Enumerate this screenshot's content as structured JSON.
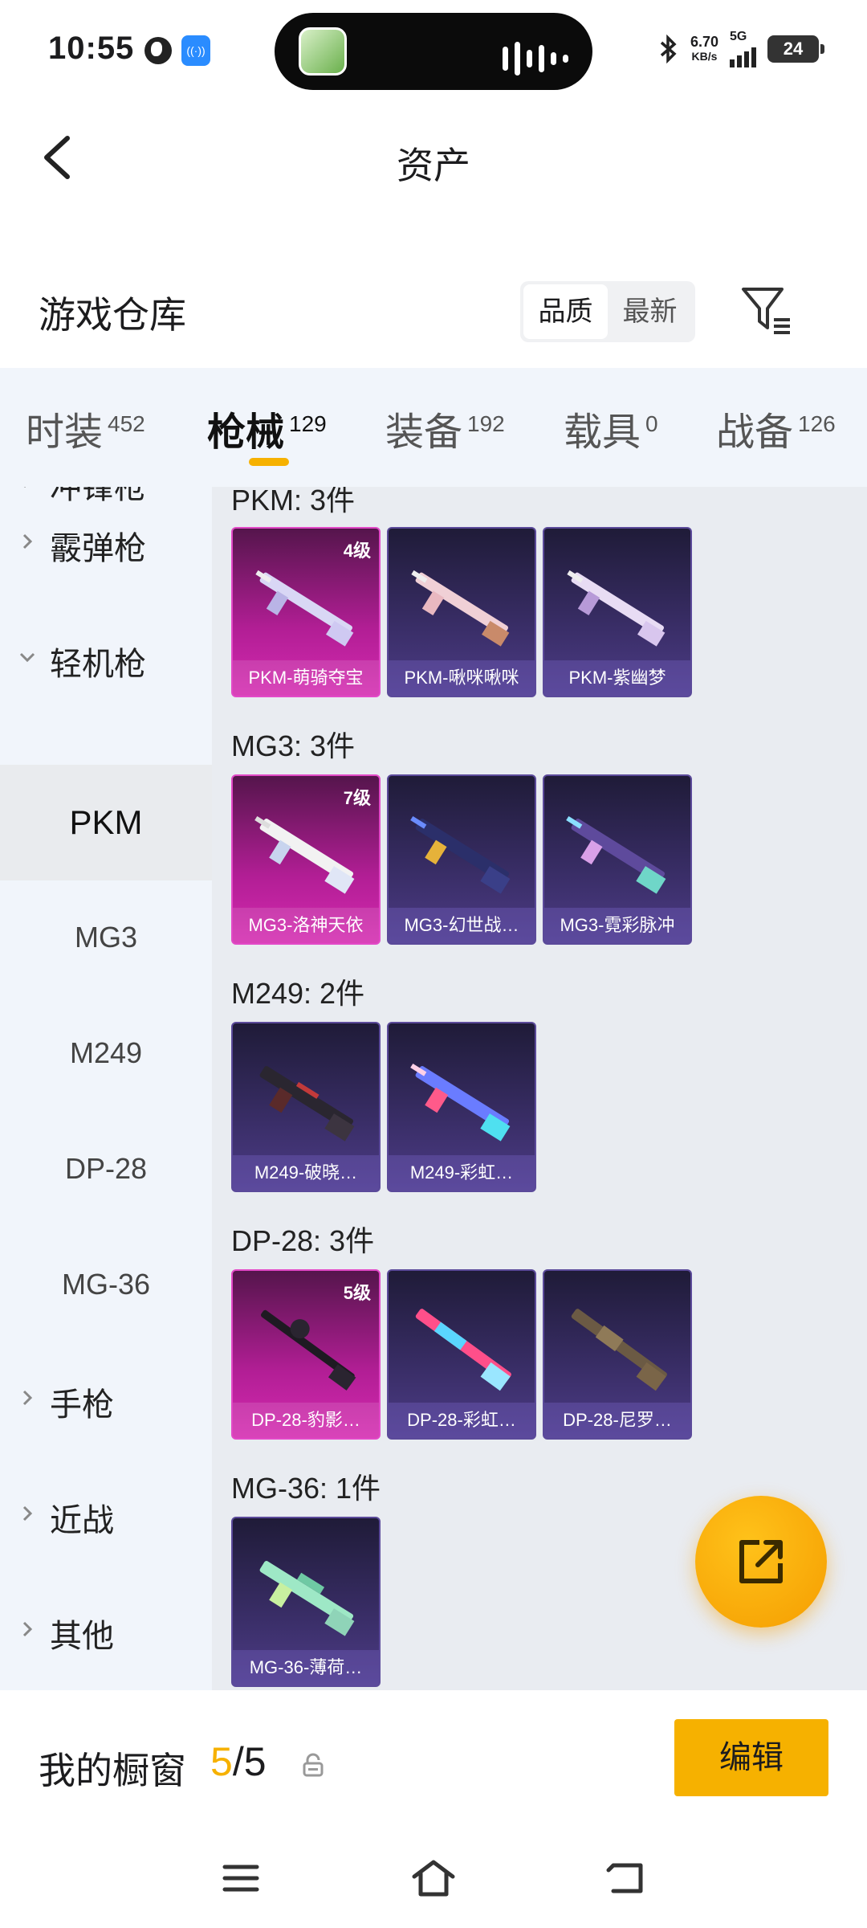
{
  "status": {
    "time": "10:55",
    "speed_value": "6.70",
    "speed_unit": "KB/s",
    "network": "5G",
    "battery": "24"
  },
  "header": {
    "title": "资产"
  },
  "warehouse": {
    "title": "游戏仓库",
    "sort_options": [
      "品质",
      "最新"
    ],
    "sort_active": 0
  },
  "tabs": [
    {
      "label": "时装",
      "count": "452"
    },
    {
      "label": "枪械",
      "count": "129"
    },
    {
      "label": "装备",
      "count": "192"
    },
    {
      "label": "载具",
      "count": "0"
    },
    {
      "label": "战备",
      "count": "126"
    }
  ],
  "active_tab": "枪械",
  "sidebar": {
    "cut_top_label": "冲锋枪",
    "categories_before": [
      {
        "label": "霰弹枪"
      }
    ],
    "open_category": "轻机枪",
    "sub_items": [
      "PKM",
      "MG3",
      "M249",
      "DP-28",
      "MG-36"
    ],
    "active_sub": "PKM",
    "categories_after": [
      {
        "label": "手枪"
      },
      {
        "label": "近战"
      },
      {
        "label": "其他"
      }
    ]
  },
  "groups": [
    {
      "title": "PKM: 3件",
      "items": [
        {
          "name": "PKM-萌骑夺宝",
          "level": "4级",
          "rarity": "pink"
        },
        {
          "name": "PKM-啾咪啾咪",
          "level": "",
          "rarity": "purple"
        },
        {
          "name": "PKM-紫幽梦",
          "level": "",
          "rarity": "purple"
        }
      ]
    },
    {
      "title": "MG3: 3件",
      "items": [
        {
          "name": "MG3-洛神天依",
          "level": "7级",
          "rarity": "pink"
        },
        {
          "name": "MG3-幻世战…",
          "level": "",
          "rarity": "purple"
        },
        {
          "name": "MG3-霓彩脉冲",
          "level": "",
          "rarity": "purple"
        }
      ]
    },
    {
      "title": "M249: 2件",
      "items": [
        {
          "name": "M249-破晓…",
          "level": "",
          "rarity": "purple"
        },
        {
          "name": "M249-彩虹…",
          "level": "",
          "rarity": "purple"
        }
      ]
    },
    {
      "title": "DP-28: 3件",
      "items": [
        {
          "name": "DP-28-豹影…",
          "level": "5级",
          "rarity": "pink"
        },
        {
          "name": "DP-28-彩虹…",
          "level": "",
          "rarity": "purple"
        },
        {
          "name": "DP-28-尼罗…",
          "level": "",
          "rarity": "purple"
        }
      ]
    },
    {
      "title": "MG-36: 1件",
      "items": [
        {
          "name": "MG-36-薄荷…",
          "level": "",
          "rarity": "purple"
        }
      ]
    }
  ],
  "showcase": {
    "label": "我的橱窗",
    "current": "5",
    "total": "/5",
    "edit_label": "编辑"
  },
  "icons": [
    "back-arrow-icon",
    "filter-icon",
    "share-icon",
    "lock-icon",
    "menu-icon",
    "home-icon",
    "back-icon"
  ]
}
